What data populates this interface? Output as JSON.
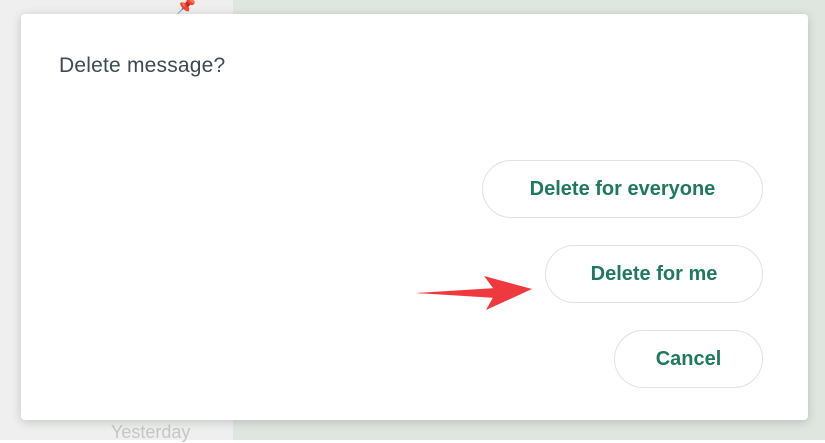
{
  "background": {
    "pin_icon": "pin-icon",
    "yesterday_label": "Yesterday"
  },
  "dialog": {
    "title": "Delete message?",
    "buttons": {
      "delete_for_everyone": "Delete for everyone",
      "delete_for_me": "Delete for me",
      "cancel": "Cancel"
    },
    "annotation": {
      "arrow_icon": "arrow-right-icon",
      "arrow_color": "#ee3a3f"
    }
  },
  "colors": {
    "accent": "#1f7a5c",
    "title_text": "#3b4a54",
    "button_border": "#dfe3e4"
  }
}
